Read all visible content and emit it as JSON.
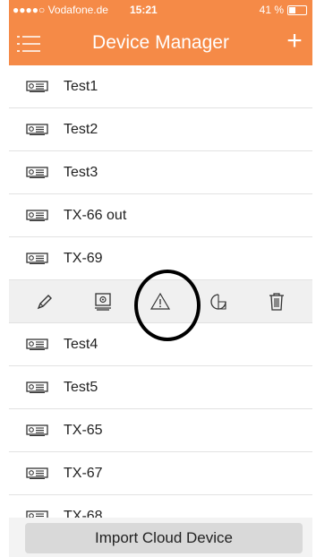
{
  "status_bar": {
    "carrier": "●●●●○ Vodafone.de",
    "wifi": "wifi-icon",
    "time": "15:21",
    "battery_text": "41 %"
  },
  "nav": {
    "title": "Device Manager",
    "add_symbol": "+",
    "menu_icon": "list-menu-icon"
  },
  "devices_top": [
    "Test1",
    "Test2",
    "Test3",
    "TX-66 out",
    "TX-69"
  ],
  "action_bar": {
    "icons": [
      "pencil-icon",
      "device-settings-icon",
      "warning-icon",
      "clock-icon",
      "trash-icon"
    ],
    "highlighted": "warning-icon"
  },
  "devices_bottom": [
    "Test4",
    "Test5",
    "TX-65",
    "TX-67",
    "TX-68"
  ],
  "bottom": {
    "import_label": "Import Cloud Device"
  },
  "colors": {
    "accent": "#f58a47",
    "background": "#ffffff",
    "divider": "#e2e2e2",
    "action_bar_bg": "#f0f0f0"
  }
}
